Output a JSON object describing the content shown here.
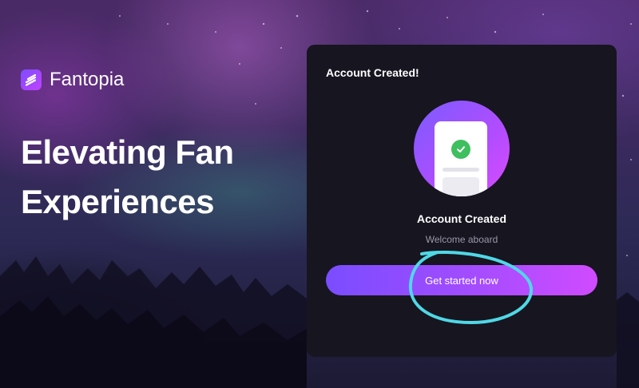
{
  "brand": {
    "name": "Fantopia",
    "icon": "fantopia-logo-icon"
  },
  "hero": {
    "line1": "Elevating Fan",
    "line2": "Experiences"
  },
  "card": {
    "title": "Account Created!",
    "illustration_icon": "document-check-icon",
    "success_title": "Account Created",
    "success_subtitle": "Welcome aboard",
    "cta_label": "Get started now"
  },
  "colors": {
    "accent_start": "#7a4dff",
    "accent_end": "#d04bff",
    "card_bg": "#171520",
    "success": "#3fbf5f",
    "annotation": "#4fd8e6"
  }
}
